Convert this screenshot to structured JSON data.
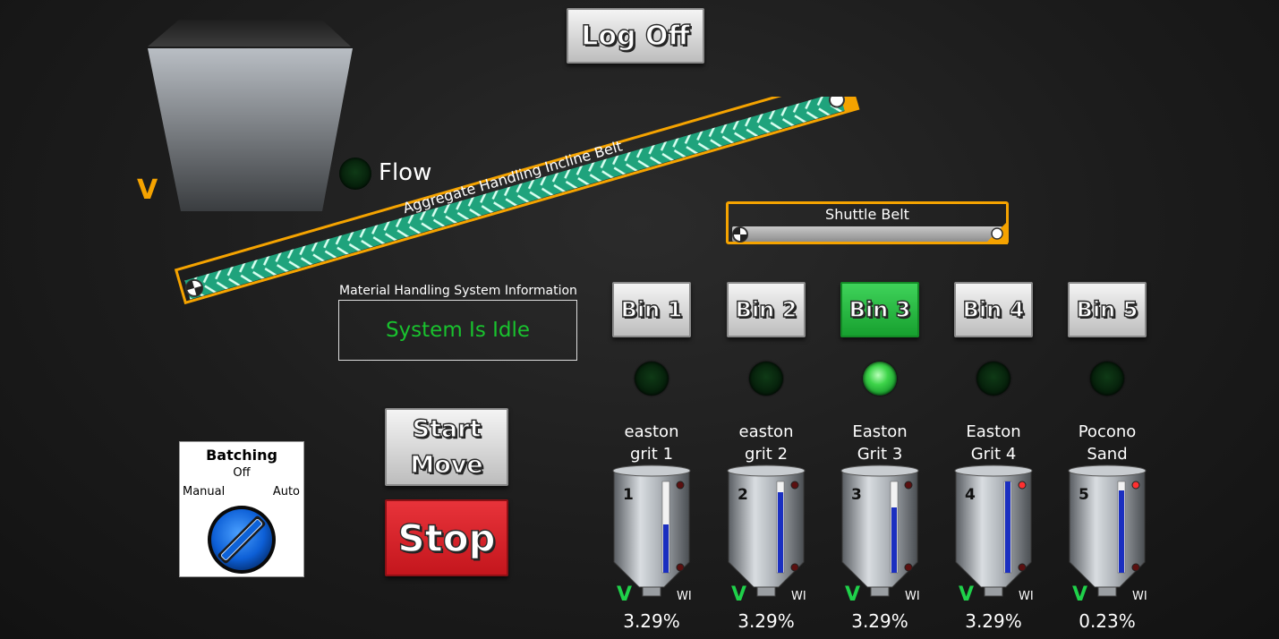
{
  "header": {
    "logoff_label": "Log Off"
  },
  "feeder": {
    "v_label": "V",
    "flow_label": "Flow"
  },
  "incline_belt": {
    "label": "Aggregate Handling Incline Belt"
  },
  "shuttle_belt": {
    "label": "Shuttle Belt"
  },
  "info": {
    "title": "Material Handling System Information",
    "status": "System Is Idle",
    "status_color": "#19c22e"
  },
  "batching": {
    "title": "Batching",
    "off": "Off",
    "manual": "Manual",
    "auto": "Auto"
  },
  "controls": {
    "start_line1": "Start",
    "start_line2": "Move",
    "stop_label": "Stop"
  },
  "bins": [
    {
      "button": "Bin 1",
      "active": false,
      "lamp_on": false,
      "name_line1": "easton",
      "name_line2": "grit 1",
      "number": "1",
      "level": 0.53,
      "v": "V",
      "wi": "WI",
      "pct": "3.29%"
    },
    {
      "button": "Bin 2",
      "active": false,
      "lamp_on": false,
      "name_line1": "easton",
      "name_line2": "grit 2",
      "number": "2",
      "level": 0.88,
      "v": "V",
      "wi": "WI",
      "pct": "3.29%"
    },
    {
      "button": "Bin 3",
      "active": true,
      "lamp_on": true,
      "name_line1": "Easton",
      "name_line2": "Grit 3",
      "number": "3",
      "level": 0.72,
      "v": "V",
      "wi": "WI",
      "pct": "3.29%"
    },
    {
      "button": "Bin 4",
      "active": false,
      "lamp_on": false,
      "name_line1": "Easton",
      "name_line2": "Grit 4",
      "number": "4",
      "level": 1.0,
      "v": "V",
      "wi": "WI",
      "pct": "3.29%"
    },
    {
      "button": "Bin 5",
      "active": false,
      "lamp_on": false,
      "name_line1": "Pocono",
      "name_line2": "Sand",
      "number": "5",
      "level": 0.9,
      "v": "V",
      "wi": "WI",
      "pct": "0.23%"
    }
  ],
  "colors": {
    "accent_orange": "#f5a300",
    "belt_green": "#1fb58a",
    "stop_red": "#d9232a",
    "active_green": "#22b33a"
  }
}
